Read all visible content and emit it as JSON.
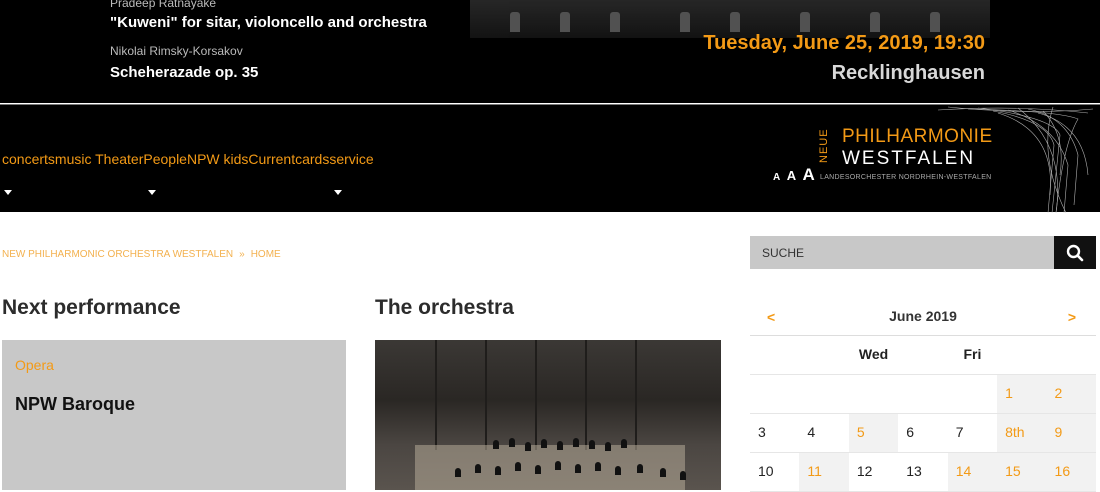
{
  "hero": {
    "composer1": "Pradeep Ratnayake",
    "work1": "\"Kuweni\" for sitar, violoncello and orchestra",
    "composer2": "Nikolai Rimsky-Korsakov",
    "work2": "Scheherazade op. 35",
    "date": "Tuesday, June 25, 2019, 19:30",
    "city": "Recklinghausen"
  },
  "nav": {
    "items": [
      "concerts",
      "music Theater",
      "People",
      "NPW kids",
      "Current",
      "cards",
      "service"
    ],
    "text_size": [
      "A",
      "A",
      "A"
    ],
    "logo": {
      "neue": "NEUE",
      "line1": "PHILHARMONIE",
      "line2": "WESTFALEN",
      "sub": "LANDESORCHESTER NORDRHEIN-WESTFALEN"
    }
  },
  "breadcrumb": {
    "org": "NEW PHILHARMONIC ORCHESTRA WESTFALEN",
    "sep": "»",
    "home": "HOME"
  },
  "next_performance": {
    "heading": "Next performance",
    "category": "Opera",
    "title": "NPW Baroque"
  },
  "orchestra": {
    "heading": "The orchestra"
  },
  "search": {
    "placeholder": "SUCHE",
    "icon": "search-icon"
  },
  "calendar": {
    "prev": "<",
    "next": ">",
    "month": "June 2019",
    "weekday_headers": [
      "",
      "",
      "Wed",
      "",
      "Fri",
      "",
      ""
    ],
    "weeks": [
      [
        "",
        "",
        "",
        "",
        "",
        "1",
        "2"
      ],
      [
        "3",
        "4",
        "5",
        "6",
        "7",
        "8th",
        "9"
      ],
      [
        "10",
        "11",
        "12",
        "13",
        "14",
        "15",
        "16"
      ]
    ]
  },
  "colors": {
    "accent": "#f39a16",
    "dark": "#000000",
    "panel": "#c8c8c8"
  }
}
